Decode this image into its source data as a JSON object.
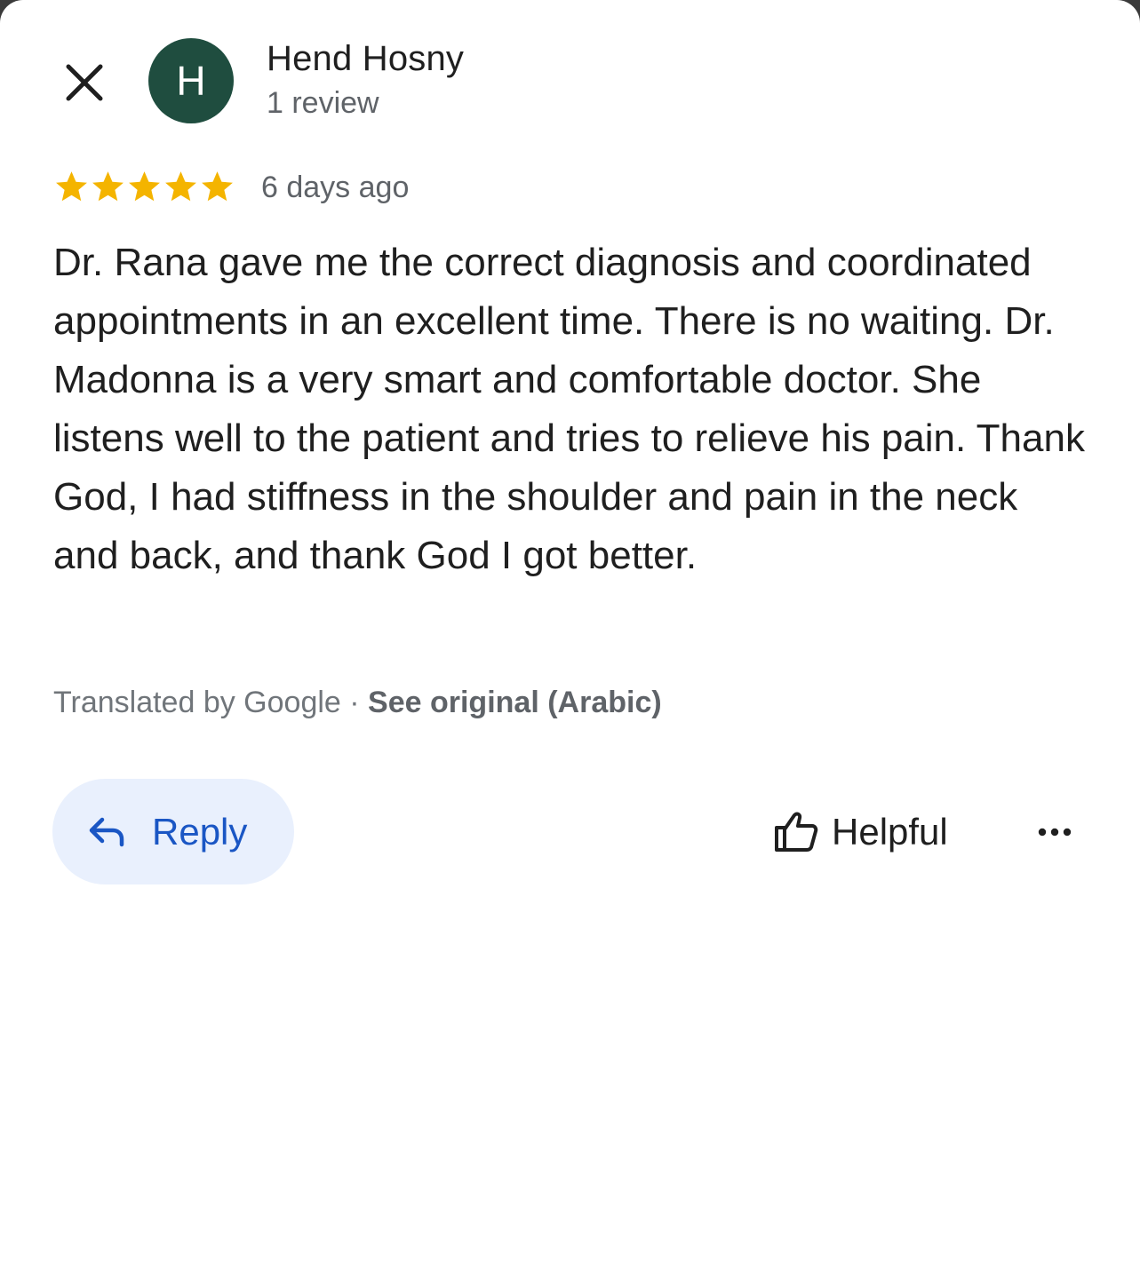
{
  "author": {
    "initial": "H",
    "name": "Hend Hosny",
    "review_count": "1 review",
    "avatar_color": "#1f4d3f"
  },
  "review": {
    "rating": 5,
    "max_rating": 5,
    "star_color": "#f4b400",
    "time_ago": "6 days ago",
    "text": "Dr. Rana gave me the correct diagnosis and coordinated appointments in an excellent time. There is no waiting. Dr. Madonna is a very smart and comfortable doctor. She listens well to the patient and tries to relieve his pain. Thank God, I had stiffness in the shoulder and pain in the neck and back, and thank God I got better.",
    "translated_by": "Translated by Google",
    "separator": " · ",
    "see_original": "See original (Arabic)"
  },
  "actions": {
    "reply_label": "Reply",
    "helpful_label": "Helpful",
    "icons": {
      "close": "close-icon",
      "reply": "reply-arrow-icon",
      "helpful": "thumbs-up-icon",
      "more": "more-horizontal-icon"
    },
    "accent_color": "#1a56c4"
  }
}
